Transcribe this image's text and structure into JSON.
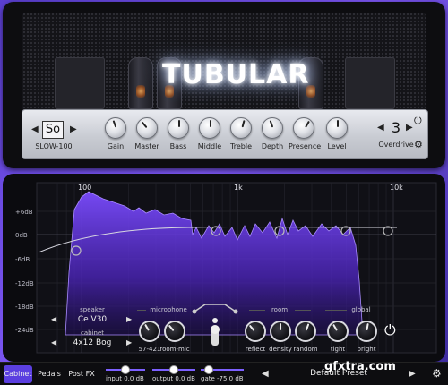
{
  "amp": {
    "logo": "TUBULAR",
    "preset_box": "So",
    "preset_name": "SLOW-100",
    "knobs": [
      {
        "label": "Gain",
        "value": 0.45
      },
      {
        "label": "Master",
        "value": 0.4
      },
      {
        "label": "Bass",
        "value": 0.5
      },
      {
        "label": "Middle",
        "value": 0.5
      },
      {
        "label": "Treble",
        "value": 0.55
      },
      {
        "label": "Depth",
        "value": 0.45
      },
      {
        "label": "Presence",
        "value": 0.6
      },
      {
        "label": "Level",
        "value": 0.5
      }
    ],
    "overdrive_value": "3",
    "overdrive_label": "Overdrive",
    "left_arrow": "◀",
    "right_arrow": "▶",
    "power_icon": "⏻",
    "gear_icon": "⚙"
  },
  "eq": {
    "freq_labels": [
      "100",
      "1k",
      "10k"
    ],
    "db_labels": [
      "+6dB",
      "0dB",
      "-6dB",
      "-12dB",
      "-18dB",
      "-24dB"
    ]
  },
  "cabinet": {
    "speaker_label": "speaker",
    "speaker_value": "Ce V30",
    "cabinet_label": "cabinet",
    "cabinet_value": "4x12 Bog",
    "microphone_label": "microphone",
    "mic_knobs": [
      "57-421",
      "room-mic"
    ],
    "room_label": "room",
    "room_knobs": [
      "reflect",
      "density",
      "random"
    ],
    "global_label": "global",
    "global_knobs": [
      "tight",
      "bright"
    ]
  },
  "bottom": {
    "tabs": [
      "Cabinet",
      "Pedals",
      "Post FX"
    ],
    "active_tab": "Cabinet",
    "sliders": [
      {
        "text": "input 0.0 dB",
        "value": 0.5
      },
      {
        "text": "output 0.0 dB",
        "value": 0.5
      },
      {
        "text": "gate -75.0 dB",
        "value": 0.1
      }
    ],
    "preset": "Default Preset",
    "watermark": "gfxtra.com"
  },
  "colors": {
    "accent": "#5b3fe0",
    "eq_fill": "#6a3fe8",
    "background": "#6a4ee6"
  }
}
